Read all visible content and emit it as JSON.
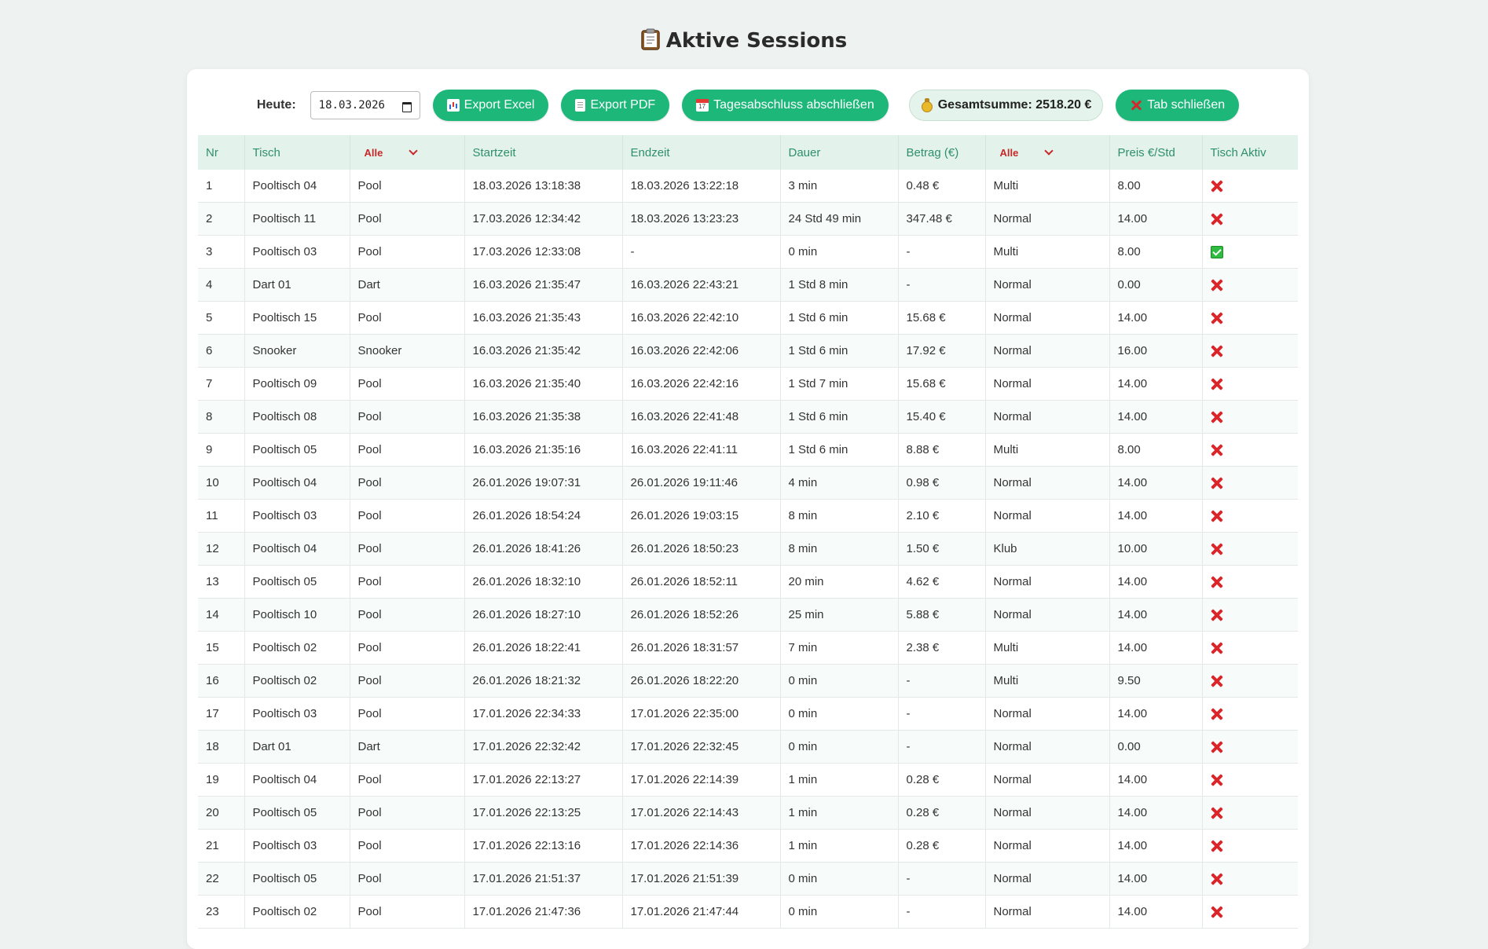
{
  "page": {
    "title": "Aktive Sessions"
  },
  "toolbar": {
    "today_label": "Heute:",
    "date_value": "18.03.2026",
    "export_excel": "Export Excel",
    "export_pdf": "Export PDF",
    "day_close": "Tagesabschluss abschließen",
    "total": "Gesamtsumme: 2518.20 €",
    "close_tab": "Tab schließen"
  },
  "table": {
    "headers": {
      "nr": "Nr",
      "tisch": "Tisch",
      "typ_filter": "Alle",
      "start": "Startzeit",
      "end": "Endzeit",
      "dauer": "Dauer",
      "betrag": "Betrag (€)",
      "tarif_filter": "Alle",
      "preis": "Preis €/Std",
      "aktiv": "Tisch Aktiv"
    },
    "rows": [
      {
        "nr": "1",
        "tisch": "Pooltisch 04",
        "typ": "Pool",
        "start": "18.03.2026 13:18:38",
        "end": "18.03.2026 13:22:18",
        "dauer": "3 min",
        "betrag": "0.48 €",
        "tarif": "Multi",
        "preis": "8.00",
        "aktiv": false
      },
      {
        "nr": "2",
        "tisch": "Pooltisch 11",
        "typ": "Pool",
        "start": "17.03.2026 12:34:42",
        "end": "18.03.2026 13:23:23",
        "dauer": "24 Std 49 min",
        "betrag": "347.48 €",
        "tarif": "Normal",
        "preis": "14.00",
        "aktiv": false
      },
      {
        "nr": "3",
        "tisch": "Pooltisch 03",
        "typ": "Pool",
        "start": "17.03.2026 12:33:08",
        "end": "-",
        "dauer": "0 min",
        "betrag": "-",
        "tarif": "Multi",
        "preis": "8.00",
        "aktiv": true
      },
      {
        "nr": "4",
        "tisch": "Dart 01",
        "typ": "Dart",
        "start": "16.03.2026 21:35:47",
        "end": "16.03.2026 22:43:21",
        "dauer": "1 Std 8 min",
        "betrag": "-",
        "tarif": "Normal",
        "preis": "0.00",
        "aktiv": false
      },
      {
        "nr": "5",
        "tisch": "Pooltisch 15",
        "typ": "Pool",
        "start": "16.03.2026 21:35:43",
        "end": "16.03.2026 22:42:10",
        "dauer": "1 Std 6 min",
        "betrag": "15.68 €",
        "tarif": "Normal",
        "preis": "14.00",
        "aktiv": false
      },
      {
        "nr": "6",
        "tisch": "Snooker",
        "typ": "Snooker",
        "start": "16.03.2026 21:35:42",
        "end": "16.03.2026 22:42:06",
        "dauer": "1 Std 6 min",
        "betrag": "17.92 €",
        "tarif": "Normal",
        "preis": "16.00",
        "aktiv": false
      },
      {
        "nr": "7",
        "tisch": "Pooltisch 09",
        "typ": "Pool",
        "start": "16.03.2026 21:35:40",
        "end": "16.03.2026 22:42:16",
        "dauer": "1 Std 7 min",
        "betrag": "15.68 €",
        "tarif": "Normal",
        "preis": "14.00",
        "aktiv": false
      },
      {
        "nr": "8",
        "tisch": "Pooltisch 08",
        "typ": "Pool",
        "start": "16.03.2026 21:35:38",
        "end": "16.03.2026 22:41:48",
        "dauer": "1 Std 6 min",
        "betrag": "15.40 €",
        "tarif": "Normal",
        "preis": "14.00",
        "aktiv": false
      },
      {
        "nr": "9",
        "tisch": "Pooltisch 05",
        "typ": "Pool",
        "start": "16.03.2026 21:35:16",
        "end": "16.03.2026 22:41:11",
        "dauer": "1 Std 6 min",
        "betrag": "8.88 €",
        "tarif": "Multi",
        "preis": "8.00",
        "aktiv": false
      },
      {
        "nr": "10",
        "tisch": "Pooltisch 04",
        "typ": "Pool",
        "start": "26.01.2026 19:07:31",
        "end": "26.01.2026 19:11:46",
        "dauer": "4 min",
        "betrag": "0.98 €",
        "tarif": "Normal",
        "preis": "14.00",
        "aktiv": false
      },
      {
        "nr": "11",
        "tisch": "Pooltisch 03",
        "typ": "Pool",
        "start": "26.01.2026 18:54:24",
        "end": "26.01.2026 19:03:15",
        "dauer": "8 min",
        "betrag": "2.10 €",
        "tarif": "Normal",
        "preis": "14.00",
        "aktiv": false
      },
      {
        "nr": "12",
        "tisch": "Pooltisch 04",
        "typ": "Pool",
        "start": "26.01.2026 18:41:26",
        "end": "26.01.2026 18:50:23",
        "dauer": "8 min",
        "betrag": "1.50 €",
        "tarif": "Klub",
        "preis": "10.00",
        "aktiv": false
      },
      {
        "nr": "13",
        "tisch": "Pooltisch 05",
        "typ": "Pool",
        "start": "26.01.2026 18:32:10",
        "end": "26.01.2026 18:52:11",
        "dauer": "20 min",
        "betrag": "4.62 €",
        "tarif": "Normal",
        "preis": "14.00",
        "aktiv": false
      },
      {
        "nr": "14",
        "tisch": "Pooltisch 10",
        "typ": "Pool",
        "start": "26.01.2026 18:27:10",
        "end": "26.01.2026 18:52:26",
        "dauer": "25 min",
        "betrag": "5.88 €",
        "tarif": "Normal",
        "preis": "14.00",
        "aktiv": false
      },
      {
        "nr": "15",
        "tisch": "Pooltisch 02",
        "typ": "Pool",
        "start": "26.01.2026 18:22:41",
        "end": "26.01.2026 18:31:57",
        "dauer": "7 min",
        "betrag": "2.38 €",
        "tarif": "Multi",
        "preis": "14.00",
        "aktiv": false
      },
      {
        "nr": "16",
        "tisch": "Pooltisch 02",
        "typ": "Pool",
        "start": "26.01.2026 18:21:32",
        "end": "26.01.2026 18:22:20",
        "dauer": "0 min",
        "betrag": "-",
        "tarif": "Multi",
        "preis": "9.50",
        "aktiv": false
      },
      {
        "nr": "17",
        "tisch": "Pooltisch 03",
        "typ": "Pool",
        "start": "17.01.2026 22:34:33",
        "end": "17.01.2026 22:35:00",
        "dauer": "0 min",
        "betrag": "-",
        "tarif": "Normal",
        "preis": "14.00",
        "aktiv": false
      },
      {
        "nr": "18",
        "tisch": "Dart 01",
        "typ": "Dart",
        "start": "17.01.2026 22:32:42",
        "end": "17.01.2026 22:32:45",
        "dauer": "0 min",
        "betrag": "-",
        "tarif": "Normal",
        "preis": "0.00",
        "aktiv": false
      },
      {
        "nr": "19",
        "tisch": "Pooltisch 04",
        "typ": "Pool",
        "start": "17.01.2026 22:13:27",
        "end": "17.01.2026 22:14:39",
        "dauer": "1 min",
        "betrag": "0.28 €",
        "tarif": "Normal",
        "preis": "14.00",
        "aktiv": false
      },
      {
        "nr": "20",
        "tisch": "Pooltisch 05",
        "typ": "Pool",
        "start": "17.01.2026 22:13:25",
        "end": "17.01.2026 22:14:43",
        "dauer": "1 min",
        "betrag": "0.28 €",
        "tarif": "Normal",
        "preis": "14.00",
        "aktiv": false
      },
      {
        "nr": "21",
        "tisch": "Pooltisch 03",
        "typ": "Pool",
        "start": "17.01.2026 22:13:16",
        "end": "17.01.2026 22:14:36",
        "dauer": "1 min",
        "betrag": "0.28 €",
        "tarif": "Normal",
        "preis": "14.00",
        "aktiv": false
      },
      {
        "nr": "22",
        "tisch": "Pooltisch 05",
        "typ": "Pool",
        "start": "17.01.2026 21:51:37",
        "end": "17.01.2026 21:51:39",
        "dauer": "0 min",
        "betrag": "-",
        "tarif": "Normal",
        "preis": "14.00",
        "aktiv": false
      },
      {
        "nr": "23",
        "tisch": "Pooltisch 02",
        "typ": "Pool",
        "start": "17.01.2026 21:47:36",
        "end": "17.01.2026 21:47:44",
        "dauer": "0 min",
        "betrag": "-",
        "tarif": "Normal",
        "preis": "14.00",
        "aktiv": false
      }
    ]
  },
  "icons": {
    "title": "clipboard-icon",
    "excel": "bar-chart-icon",
    "pdf": "document-icon",
    "day_close": "calendar-icon",
    "total": "money-bag-icon",
    "close_tab": "close-icon",
    "active": "check-box-icon",
    "inactive": "cross-mark-icon"
  },
  "colors": {
    "accent": "#1db77a",
    "header_bg": "#e3f3eb",
    "header_text": "#2f8f6a",
    "filter_text": "#c62828",
    "inactive": "#d8262b",
    "active": "#2fbb3f"
  }
}
